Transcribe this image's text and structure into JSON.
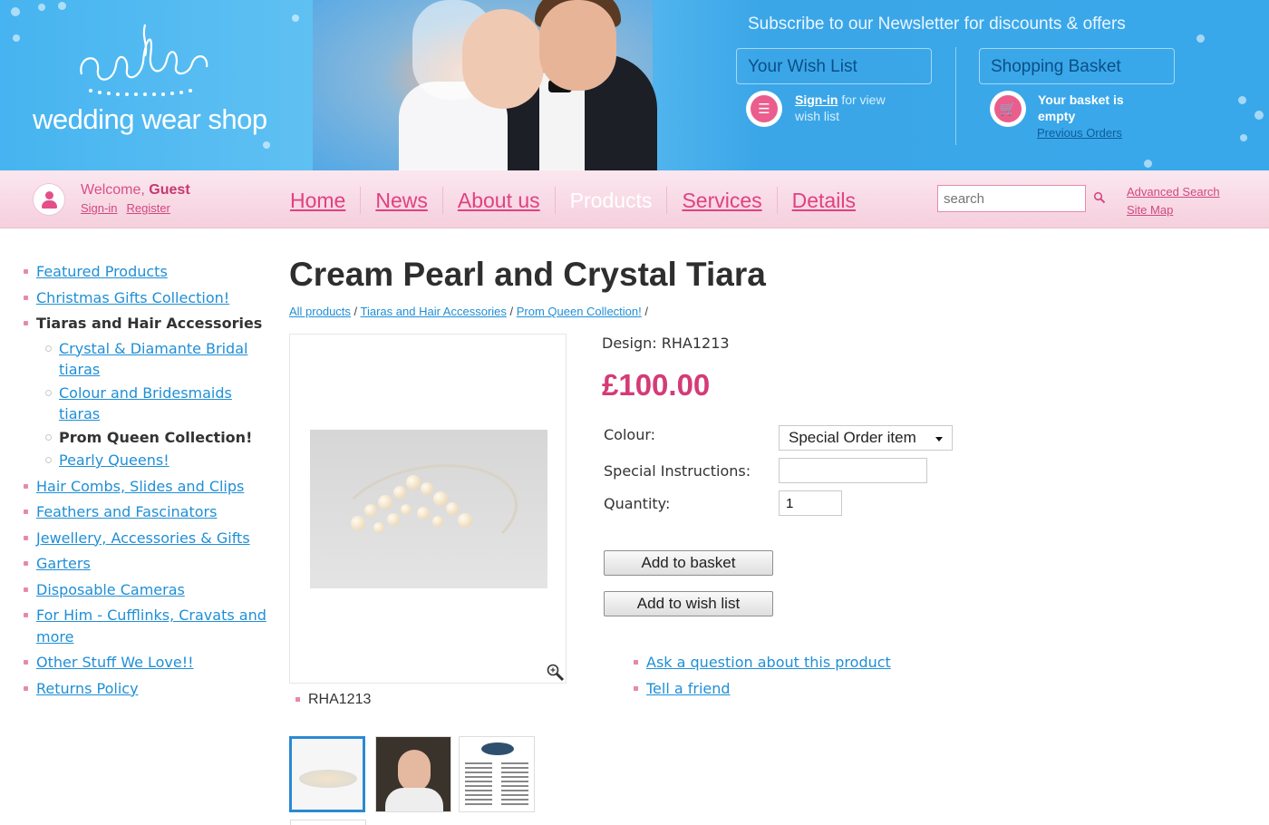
{
  "header": {
    "logo_text": "wedding wear shop",
    "newsletter": "Subscribe to our Newsletter for discounts & offers",
    "wishlist": {
      "title": "Your Wish List",
      "signin_link": "Sign-in",
      "suffix": " for view wish list"
    },
    "basket": {
      "title": "Shopping Basket",
      "status": "Your basket is empty",
      "previous_orders": "Previous Orders"
    }
  },
  "userbar": {
    "welcome": "Welcome,",
    "user": "Guest",
    "signin": "Sign-in",
    "register": "Register"
  },
  "nav": {
    "items": [
      "Home",
      "News",
      "About us",
      "Products",
      "Services",
      "Details"
    ],
    "active": "Products"
  },
  "search": {
    "placeholder": "search",
    "advanced": "Advanced Search",
    "sitemap": "Site Map"
  },
  "sidebar": {
    "items": [
      "Featured Products",
      "Christmas Gifts Collection!",
      "Tiaras and Hair Accessories",
      "Hair Combs, Slides and Clips",
      "Feathers and Fascinators",
      "Jewellery, Accessories & Gifts",
      "Garters",
      "Disposable Cameras",
      "For Him - Cufflinks, Cravats and more",
      "Other Stuff We Love!!",
      "Returns Policy"
    ],
    "subitems": [
      "Crystal & Diamante Bridal tiaras",
      "Colour and Bridesmaids tiaras",
      "Prom Queen Collection!",
      "Pearly Queens!"
    ]
  },
  "product": {
    "title": "Cream Pearl and Crystal Tiara",
    "breadcrumb": [
      "All products",
      "Tiaras and Hair Accessories",
      "Prom Queen Collection!"
    ],
    "design_label": "Design:",
    "design_code": "RHA1213",
    "price": "£100.00",
    "colour_label": "Colour:",
    "colour_value": "Special Order item",
    "instructions_label": "Special Instructions:",
    "quantity_label": "Quantity:",
    "quantity_value": "1",
    "add_basket": "Add to basket",
    "add_wishlist": "Add to wish list",
    "ask_question": "Ask a question about this product",
    "tell_friend": "Tell a friend",
    "image_caption": "RHA1213"
  },
  "colors": {
    "accent_pink": "#d43b77",
    "link_blue": "#1f8fd6",
    "banner_blue": "#46b4f0",
    "nav_pink": "#f5cfdd"
  }
}
